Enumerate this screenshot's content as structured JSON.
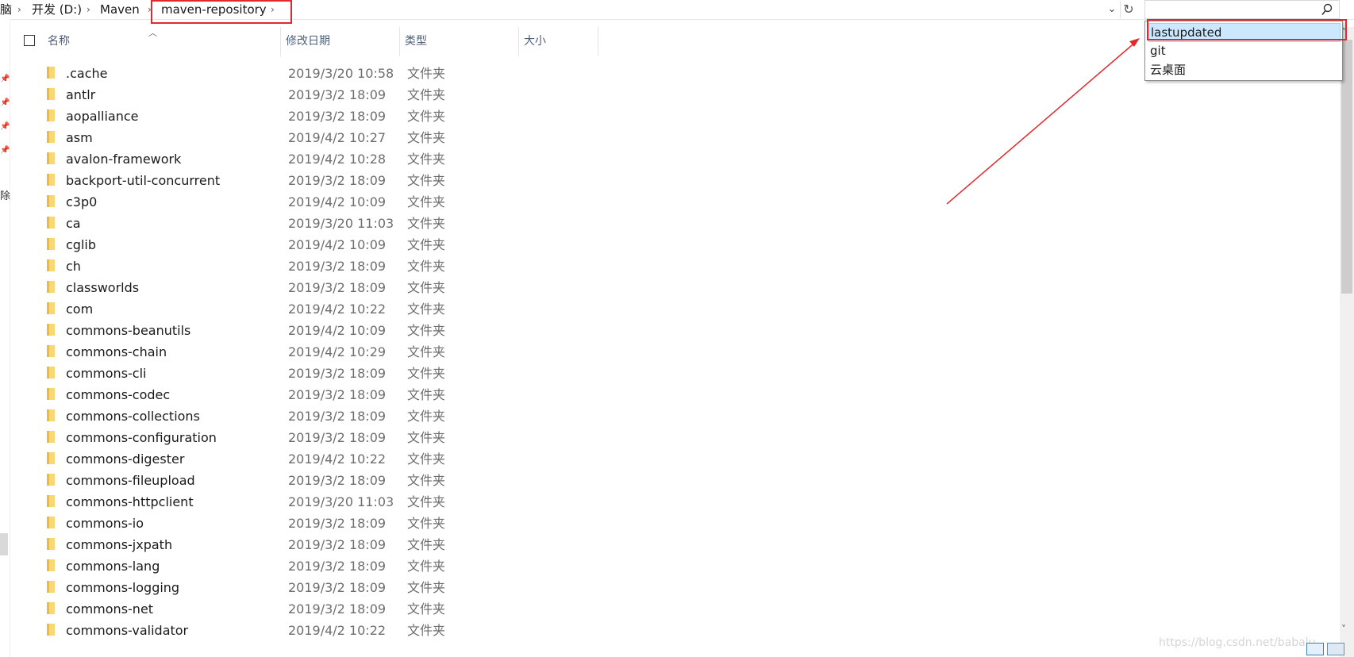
{
  "address_bar": {
    "segments": [
      "脑",
      "开发 (D:)",
      "Maven",
      "maven-repository"
    ]
  },
  "search": {
    "value": "",
    "suggestions": [
      "lastupdated",
      "git",
      "云桌面"
    ]
  },
  "columns": {
    "name": "名称",
    "modified": "修改日期",
    "type": "类型",
    "size": "大小"
  },
  "navigation_pane": {
    "partial_label": "除"
  },
  "files": [
    {
      "name": ".cache",
      "modified": "2019/3/20 10:58",
      "type": "文件夹"
    },
    {
      "name": "antlr",
      "modified": "2019/3/2 18:09",
      "type": "文件夹"
    },
    {
      "name": "aopalliance",
      "modified": "2019/3/2 18:09",
      "type": "文件夹"
    },
    {
      "name": "asm",
      "modified": "2019/4/2 10:27",
      "type": "文件夹"
    },
    {
      "name": "avalon-framework",
      "modified": "2019/4/2 10:28",
      "type": "文件夹"
    },
    {
      "name": "backport-util-concurrent",
      "modified": "2019/3/2 18:09",
      "type": "文件夹"
    },
    {
      "name": "c3p0",
      "modified": "2019/4/2 10:09",
      "type": "文件夹"
    },
    {
      "name": "ca",
      "modified": "2019/3/20 11:03",
      "type": "文件夹"
    },
    {
      "name": "cglib",
      "modified": "2019/4/2 10:09",
      "type": "文件夹"
    },
    {
      "name": "ch",
      "modified": "2019/3/2 18:09",
      "type": "文件夹"
    },
    {
      "name": "classworlds",
      "modified": "2019/3/2 18:09",
      "type": "文件夹"
    },
    {
      "name": "com",
      "modified": "2019/4/2 10:22",
      "type": "文件夹"
    },
    {
      "name": "commons-beanutils",
      "modified": "2019/4/2 10:09",
      "type": "文件夹"
    },
    {
      "name": "commons-chain",
      "modified": "2019/4/2 10:29",
      "type": "文件夹"
    },
    {
      "name": "commons-cli",
      "modified": "2019/3/2 18:09",
      "type": "文件夹"
    },
    {
      "name": "commons-codec",
      "modified": "2019/3/2 18:09",
      "type": "文件夹"
    },
    {
      "name": "commons-collections",
      "modified": "2019/3/2 18:09",
      "type": "文件夹"
    },
    {
      "name": "commons-configuration",
      "modified": "2019/3/2 18:09",
      "type": "文件夹"
    },
    {
      "name": "commons-digester",
      "modified": "2019/4/2 10:22",
      "type": "文件夹"
    },
    {
      "name": "commons-fileupload",
      "modified": "2019/3/2 18:09",
      "type": "文件夹"
    },
    {
      "name": "commons-httpclient",
      "modified": "2019/3/20 11:03",
      "type": "文件夹"
    },
    {
      "name": "commons-io",
      "modified": "2019/3/2 18:09",
      "type": "文件夹"
    },
    {
      "name": "commons-jxpath",
      "modified": "2019/3/2 18:09",
      "type": "文件夹"
    },
    {
      "name": "commons-lang",
      "modified": "2019/3/2 18:09",
      "type": "文件夹"
    },
    {
      "name": "commons-logging",
      "modified": "2019/3/2 18:09",
      "type": "文件夹"
    },
    {
      "name": "commons-net",
      "modified": "2019/3/2 18:09",
      "type": "文件夹"
    },
    {
      "name": "commons-validator",
      "modified": "2019/4/2 10:22",
      "type": "文件夹"
    }
  ],
  "watermark": "https://blog.csdn.net/babalu",
  "colors": {
    "highlight_red": "#e0292c",
    "folder_yellow": "#f8d775",
    "selection_blue": "#cce8ff"
  },
  "icons": [
    "folder-icon",
    "search-icon",
    "refresh-icon",
    "chevron-down-icon",
    "chevron-right-icon",
    "pin-icon"
  ]
}
